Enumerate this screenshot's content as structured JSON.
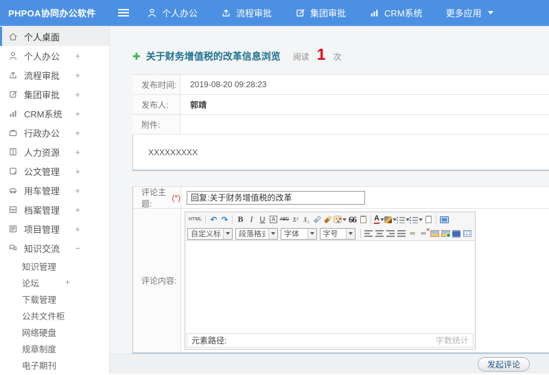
{
  "header": {
    "logo": "PHPOA协同办公软件",
    "nav": [
      {
        "label": "个人办公"
      },
      {
        "label": "流程审批"
      },
      {
        "label": "集团审批"
      },
      {
        "label": "CRM系统"
      },
      {
        "label": "更多应用"
      }
    ]
  },
  "sidebar": {
    "items": [
      {
        "label": "个人桌面",
        "expand": ""
      },
      {
        "label": "个人办公",
        "expand": "+"
      },
      {
        "label": "流程审批",
        "expand": "+"
      },
      {
        "label": "集团审批",
        "expand": "+"
      },
      {
        "label": "CRM系统",
        "expand": "+"
      },
      {
        "label": "行政办公",
        "expand": "+"
      },
      {
        "label": "人力资源",
        "expand": "+"
      },
      {
        "label": "公文管理",
        "expand": "+"
      },
      {
        "label": "用车管理",
        "expand": "+"
      },
      {
        "label": "档案管理",
        "expand": "+"
      },
      {
        "label": "项目管理",
        "expand": "+"
      },
      {
        "label": "知识交流",
        "expand": "−"
      }
    ],
    "subitems": [
      {
        "label": "知识管理",
        "expand": ""
      },
      {
        "label": "论坛",
        "expand": "+"
      },
      {
        "label": "下载管理",
        "expand": ""
      },
      {
        "label": "公共文件柜",
        "expand": ""
      },
      {
        "label": "网络硬盘",
        "expand": ""
      },
      {
        "label": "规章制度",
        "expand": ""
      },
      {
        "label": "电子期刊",
        "expand": ""
      }
    ]
  },
  "article": {
    "title": "关于财务增值税的改革信息浏览",
    "read_label": "阅读",
    "read_count": "1",
    "read_unit": "次",
    "fields": [
      {
        "label": "发布时间:",
        "value": "2019-08-20 09:28:23"
      },
      {
        "label": "发布人:",
        "value": "郭靖"
      },
      {
        "label": "附件:",
        "value": ""
      }
    ],
    "content": "XXXXXXXXX"
  },
  "comment": {
    "subject_label": "评论主题:",
    "required_mark": "(*)",
    "subject_value": "回复:关于财务增值税的改革",
    "content_label": "评论内容:",
    "submit_label": "发起评论"
  },
  "editor": {
    "html_label": "HTML",
    "bold_label": "B",
    "italic_label": "I",
    "underline_label": "U",
    "boxa_label": "A",
    "strike_label": "ABC",
    "sup_label": "X²",
    "sub_label": "X₂",
    "quote_label": "66",
    "fontcolor_label": "A",
    "dropdowns": [
      {
        "label": "自定义标题"
      },
      {
        "label": "段落格式"
      },
      {
        "label": "字体"
      },
      {
        "label": "字号"
      }
    ],
    "footer_left": "元素路径:",
    "footer_right": "字数统计"
  },
  "colors": {
    "header_blue": "#4b90e2",
    "title_teal": "#1e7290",
    "count_red": "#e60012",
    "accent_border": "#b5cbdb",
    "plus_green": "#3cb54a"
  }
}
